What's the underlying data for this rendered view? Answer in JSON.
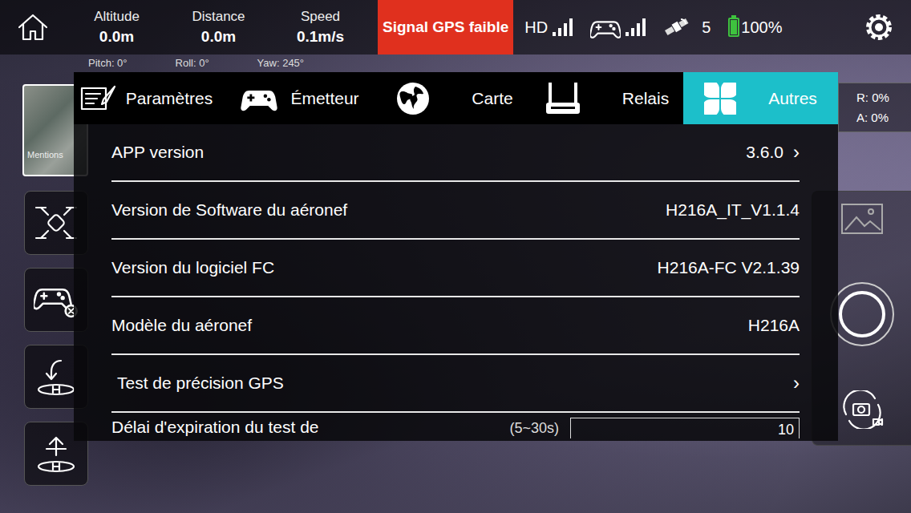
{
  "top_bar": {
    "stats": [
      {
        "label": "Altitude",
        "value": "0.0m"
      },
      {
        "label": "Distance",
        "value": "0.0m"
      },
      {
        "label": "Speed",
        "value": "0.1m/s"
      }
    ],
    "alert": "Signal GPS faible",
    "video_link": {
      "label": "HD",
      "level": 1
    },
    "remote_link": {
      "level": 1
    },
    "satellites": "5",
    "battery": {
      "value": "100%",
      "level": 1
    }
  },
  "telemetry": [
    "Pitch: 0°",
    "Roll: 0°",
    "Yaw: 245°"
  ],
  "map_thumbnail": {
    "label": "Mentions"
  },
  "ratios": [
    "R: 0%",
    "A: 0%"
  ],
  "tabs": [
    {
      "label": "Paramètres",
      "selected": false
    },
    {
      "label": "Émetteur",
      "selected": false
    },
    {
      "label": "Carte",
      "selected": false
    },
    {
      "label": "Relais",
      "selected": false
    },
    {
      "label": "Autres",
      "selected": true
    }
  ],
  "rows": [
    {
      "kind": "link",
      "label": "APP version",
      "value": "3.6.0",
      "arrow": "›"
    },
    {
      "kind": "info",
      "label": "Version de Software du aéronef",
      "value": "H216A_IT_V1.1.4"
    },
    {
      "kind": "info",
      "label": "Version du logiciel FC",
      "value": "H216A-FC  V2.1.39"
    },
    {
      "kind": "info",
      "label": "Modèle du aéronef",
      "value": "H216A"
    },
    {
      "kind": "link",
      "label": "Test de précision GPS",
      "arrow": "›"
    },
    {
      "kind": "input",
      "label": "Délai d'expiration du test de",
      "hint": "(5~30s)",
      "value": "10"
    }
  ]
}
